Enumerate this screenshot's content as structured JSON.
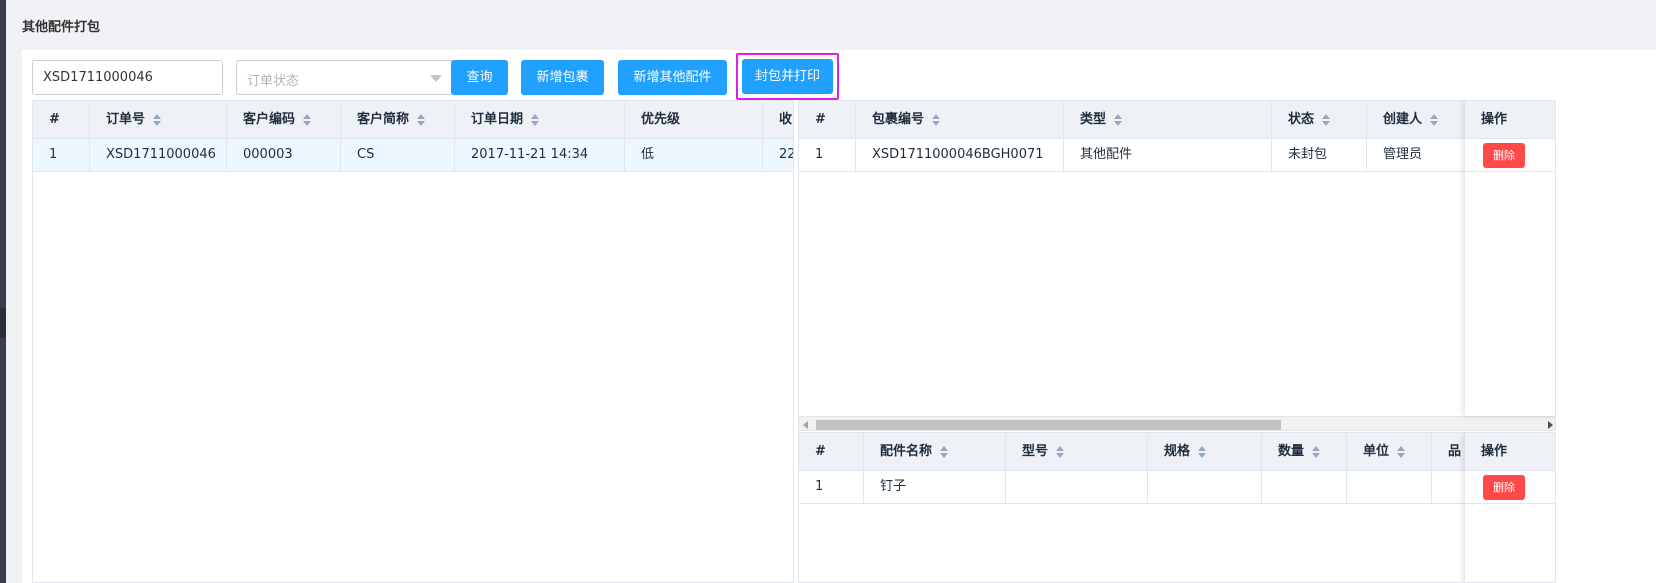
{
  "page": {
    "title": "其他配件打包"
  },
  "toolbar": {
    "order_no_value": "XSD1711000046",
    "status_placeholder": "订单状态",
    "query_label": "查询",
    "add_package_label": "新增包裹",
    "add_other_label": "新增其他配件",
    "seal_print_label": "封包并打印"
  },
  "orders_table": {
    "headers": [
      "#",
      "订单号",
      "客户编码",
      "客户简称",
      "订单日期",
      "优先级",
      "收"
    ],
    "rows": [
      [
        "1",
        "XSD1711000046",
        "000003",
        "CS",
        "2017-11-21 14:34",
        "低",
        "22"
      ]
    ]
  },
  "packages_table": {
    "headers": [
      "#",
      "包裹编号",
      "类型",
      "状态",
      "创建人",
      "操作"
    ],
    "rows": [
      {
        "cells": [
          "1",
          "XSD1711000046BGH0071",
          "其他配件",
          "未封包",
          "管理员"
        ],
        "action": "删除"
      }
    ]
  },
  "parts_table": {
    "headers": [
      "#",
      "配件名称",
      "型号",
      "规格",
      "数量",
      "单位",
      "品",
      "操作"
    ],
    "rows": [
      {
        "cells": [
          "1",
          "钉子",
          "",
          "",
          "",
          "",
          ""
        ],
        "action": "删除"
      }
    ]
  },
  "colors": {
    "primary": "#20a0ff",
    "danger": "#ff4949",
    "highlight_border": "#e020e0",
    "header_bg": "#eef1f6",
    "selected_row": "#edf7ff"
  }
}
